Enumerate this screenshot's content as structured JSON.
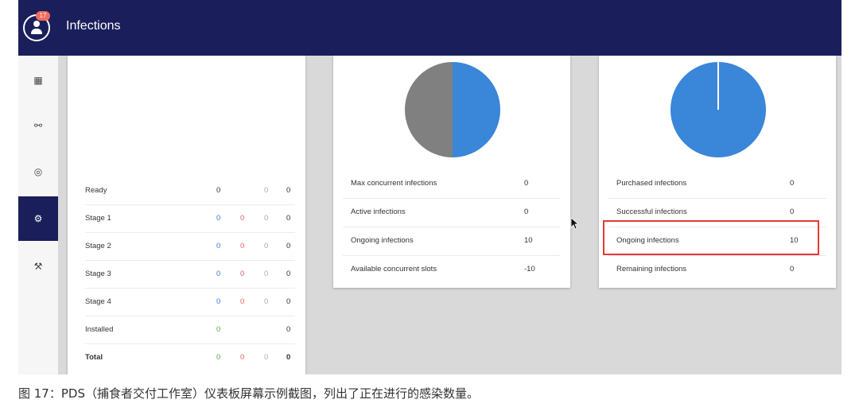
{
  "header": {
    "title": "Infections",
    "badge": "17"
  },
  "sidebar": {
    "items": [
      {
        "icon": "dashboard-icon",
        "glyph": "▦"
      },
      {
        "icon": "network-icon",
        "glyph": "⚯"
      },
      {
        "icon": "target-icon",
        "glyph": "◎"
      },
      {
        "icon": "bug-icon",
        "glyph": "⚙",
        "active": true
      },
      {
        "icon": "tools-icon",
        "glyph": "⚒"
      }
    ]
  },
  "stages": {
    "rows": [
      {
        "label": "Ready",
        "c1": "0",
        "c2": "",
        "c3": "0",
        "c4": "0"
      },
      {
        "label": "Stage 1",
        "c1": "0",
        "c2": "0",
        "c3": "0",
        "c4": "0"
      },
      {
        "label": "Stage 2",
        "c1": "0",
        "c2": "0",
        "c3": "0",
        "c4": "0"
      },
      {
        "label": "Stage 3",
        "c1": "0",
        "c2": "0",
        "c3": "0",
        "c4": "0"
      },
      {
        "label": "Stage 4",
        "c1": "0",
        "c2": "0",
        "c3": "0",
        "c4": "0"
      },
      {
        "label": "Installed",
        "c1": "0",
        "c2": "",
        "c3": "",
        "c4": "0"
      },
      {
        "label": "Total",
        "c1": "0",
        "c2": "0",
        "c3": "0",
        "c4": "0"
      }
    ]
  },
  "concurrency": {
    "pie": {
      "colors": [
        "#808080",
        "#3a86d8"
      ]
    },
    "rows": [
      {
        "label": "Max concurrent infections",
        "value": "0"
      },
      {
        "label": "Active infections",
        "value": "0"
      },
      {
        "label": "Ongoing infections",
        "value": "10"
      },
      {
        "label": "Available concurrent slots",
        "value": "-10"
      }
    ]
  },
  "purchases": {
    "pie": {
      "colors": [
        "#3a86d8"
      ]
    },
    "rows": [
      {
        "label": "Purchased infections",
        "value": "0"
      },
      {
        "label": "Successful infections",
        "value": "0"
      },
      {
        "label": "Ongoing infections",
        "value": "10"
      },
      {
        "label": "Remaining infections",
        "value": "0"
      }
    ]
  },
  "caption": "图 17：PDS（捕食者交付工作室）仪表板屏幕示例截图，列出了正在进行的感染数量。"
}
